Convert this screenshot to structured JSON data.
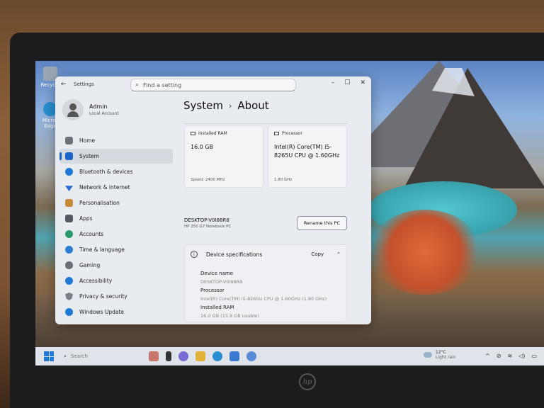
{
  "window": {
    "title": "Settings",
    "search_placeholder": "Find a setting",
    "controls": [
      "–",
      "☐",
      "✕"
    ]
  },
  "profile": {
    "name": "Admin",
    "account_type": "Local Account"
  },
  "nav": [
    {
      "label": "Home",
      "icon": "home-icon",
      "color": "#6b6f78"
    },
    {
      "label": "System",
      "icon": "system-icon",
      "color": "#1a63c7",
      "active": true
    },
    {
      "label": "Bluetooth & devices",
      "icon": "bluetooth-icon",
      "color": "#1f78d6"
    },
    {
      "label": "Network & internet",
      "icon": "wifi-icon",
      "color": "#2b6ed4"
    },
    {
      "label": "Personalisation",
      "icon": "brush-icon",
      "color": "#c88a3a"
    },
    {
      "label": "Apps",
      "icon": "apps-icon",
      "color": "#555a62"
    },
    {
      "label": "Accounts",
      "icon": "accounts-icon",
      "color": "#2a9a6a"
    },
    {
      "label": "Time & language",
      "icon": "globe-icon",
      "color": "#2a7fd0"
    },
    {
      "label": "Gaming",
      "icon": "gamepad-icon",
      "color": "#6b6f78"
    },
    {
      "label": "Accessibility",
      "icon": "accessibility-icon",
      "color": "#1f78d6"
    },
    {
      "label": "Privacy & security",
      "icon": "shield-icon",
      "color": "#7a808a"
    },
    {
      "label": "Windows Update",
      "icon": "update-icon",
      "color": "#1f78d6"
    }
  ],
  "breadcrumb": {
    "parent": "System",
    "separator": "›",
    "current": "About"
  },
  "cards": {
    "ram": {
      "label": "Installed RAM",
      "value": "16.0 GB",
      "sub": "Speed: 2400 MHz"
    },
    "processor": {
      "label": "Processor",
      "value": "Intel(R) Core(TM) i5-8265U CPU @ 1.60GHz",
      "sub": "1.80 GHz"
    }
  },
  "pc": {
    "name": "DESKTOP-V0I88R8",
    "model": "HP 250 G7 Notebook PC",
    "rename_label": "Rename this PC"
  },
  "specs": {
    "title": "Device specifications",
    "copy_label": "Copy",
    "rows": [
      {
        "key": "Device name",
        "value": "DESKTOP-V0I88R8"
      },
      {
        "key": "Processor",
        "value": "Intel(R) Core(TM) i5-8265U CPU @ 1.60GHz (1.80 GHz)"
      },
      {
        "key": "Installed RAM",
        "value": "16.0 GB (15.9 GB usable)"
      }
    ]
  },
  "desktop": {
    "icons": [
      "Recycle",
      "Micros Edge"
    ]
  },
  "taskbar": {
    "search_label": "Search",
    "weather_temp": "12°C",
    "weather_desc": "Light rain",
    "tray": [
      "^",
      "⊘",
      "≋",
      "◁)",
      "▭"
    ],
    "apps": [
      {
        "name": "widgets-icon",
        "color": "#c8756a"
      },
      {
        "name": "taskview-icon",
        "color": "#333"
      },
      {
        "name": "copilot-icon",
        "color": "#7a6ad4"
      },
      {
        "name": "explorer-icon",
        "color": "#e0b23a"
      },
      {
        "name": "edge-icon",
        "color": "#2a8fd0"
      },
      {
        "name": "store-icon",
        "color": "#3a7ad0"
      },
      {
        "name": "settings-icon",
        "color": "#5a8ad8"
      }
    ]
  },
  "device": {
    "logo_text": "hp"
  }
}
